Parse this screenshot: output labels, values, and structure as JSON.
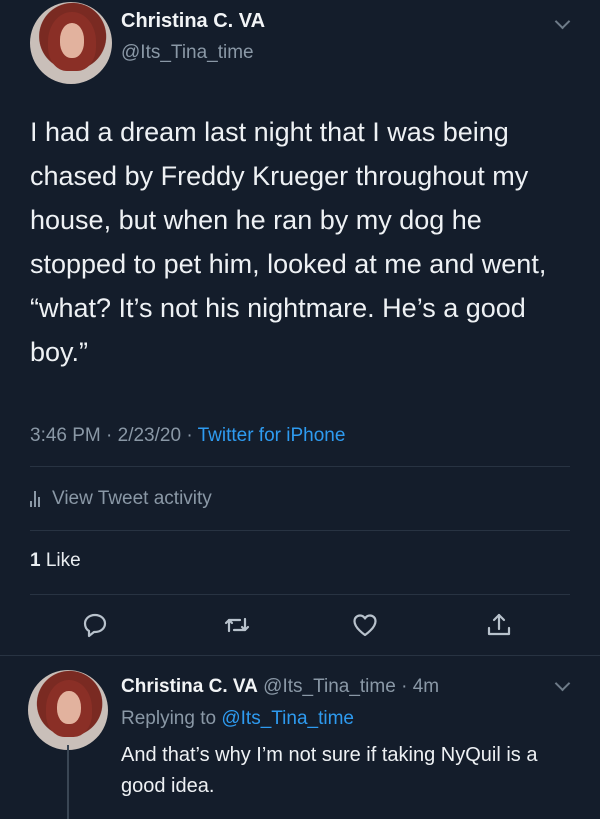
{
  "tweet": {
    "author_name": "Christina C. VA",
    "author_handle": "@Its_Tina_time",
    "text": "I had a dream last night that I was being chased by Freddy Krueger throughout my house, but when he ran by my dog he stopped to pet him, looked at me and went, “what? It’s not his nightmare. He’s a good boy.”",
    "timestamp": "3:46 PM · 2/23/20 · ",
    "source": "Twitter for iPhone",
    "activity_label": "View Tweet activity",
    "like_count": "1",
    "like_label": " Like"
  },
  "reply": {
    "author_name": "Christina C. VA",
    "author_handle": "@Its_Tina_time",
    "time_ago": " · 4m",
    "replying_prefix": "Replying to ",
    "replying_mention": "@Its_Tina_time",
    "text": "And that’s why I’m not sure if taking NyQuil is a good idea."
  },
  "icons": {
    "actions": [
      "reply-icon",
      "retweet-icon",
      "like-icon",
      "share-icon"
    ],
    "more": "chevron-down-icon",
    "activity": "bar-chart-icon"
  },
  "colors": {
    "background": "#141d2b",
    "text": "#eef1f4",
    "secondary": "#8a98a6",
    "link": "#2e9bf0"
  }
}
